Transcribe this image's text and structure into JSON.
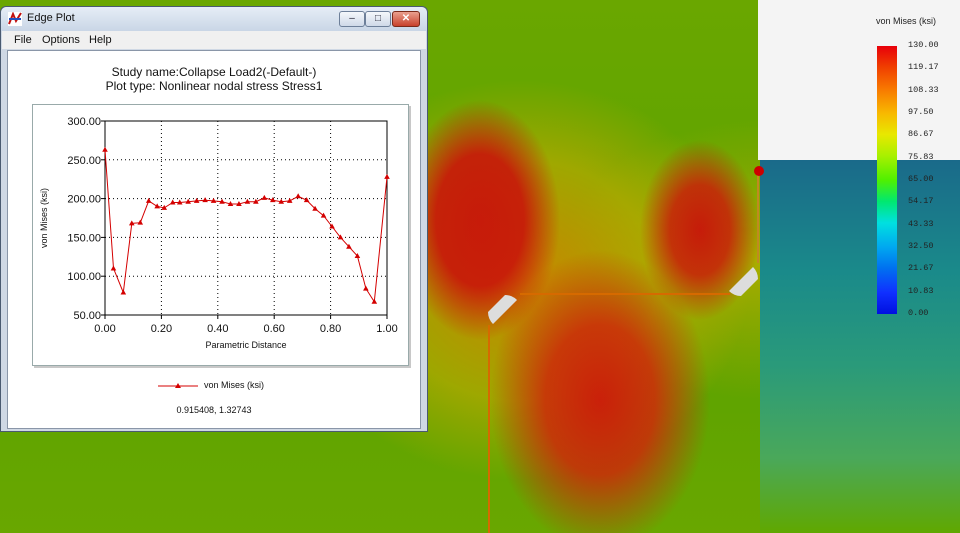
{
  "window": {
    "title": "Edge Plot",
    "menu": [
      "File",
      "Options",
      "Help"
    ],
    "buttons": {
      "minimize": "–",
      "maximize": "□",
      "close": "✕"
    }
  },
  "plot": {
    "title_line1": "Study name:Collapse Load2(-Default-)",
    "title_line2": "Plot type: Nonlinear nodal stress Stress1",
    "legend_label": "von Mises (ksi)",
    "coord_readout": "0.915408, 1.32743"
  },
  "chart_data": {
    "type": "line",
    "xlabel": "Parametric Distance",
    "ylabel": "von Mises (ksi)",
    "xlim": [
      0.0,
      1.0
    ],
    "ylim": [
      50.0,
      300.0
    ],
    "xticks": [
      "0.00",
      "0.20",
      "0.40",
      "0.60",
      "0.80",
      "1.00"
    ],
    "yticks": [
      "50.00",
      "100.00",
      "150.00",
      "200.00",
      "250.00",
      "300.00"
    ],
    "grid": true,
    "color": "#d40000",
    "series": [
      {
        "name": "von Mises (ksi)",
        "x": [
          0.0,
          0.03,
          0.065,
          0.095,
          0.125,
          0.155,
          0.185,
          0.21,
          0.24,
          0.265,
          0.295,
          0.325,
          0.355,
          0.385,
          0.415,
          0.445,
          0.475,
          0.505,
          0.535,
          0.565,
          0.595,
          0.625,
          0.655,
          0.685,
          0.715,
          0.745,
          0.775,
          0.805,
          0.835,
          0.865,
          0.895,
          0.925,
          0.955,
          1.0
        ],
        "y": [
          263,
          110,
          79,
          168,
          169,
          197,
          190,
          188,
          195,
          195,
          196,
          197,
          198,
          197,
          196,
          193,
          193,
          196,
          196,
          201,
          198,
          196,
          197,
          203,
          198,
          187,
          178,
          164,
          150,
          138,
          126,
          84,
          67,
          228
        ]
      }
    ]
  },
  "legend": {
    "title": "von Mises (ksi)",
    "values": [
      "130.00",
      "119.17",
      "108.33",
      "97.50",
      "86.67",
      "75.83",
      "65.00",
      "54.17",
      "43.33",
      "32.50",
      "21.67",
      "10.83",
      "0.00"
    ]
  }
}
